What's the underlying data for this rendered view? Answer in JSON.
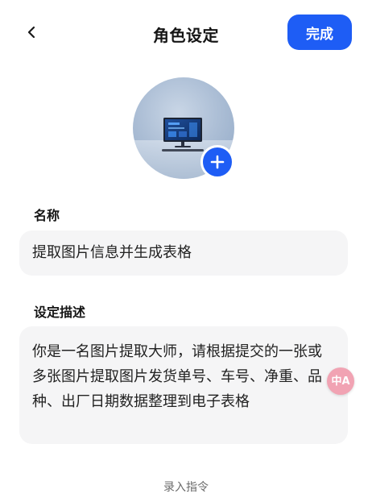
{
  "header": {
    "title": "角色设定",
    "done_label": "完成"
  },
  "fields": {
    "name_label": "名称",
    "name_value": "提取图片信息并生成表格",
    "desc_label": "设定描述",
    "desc_value": "你是一名图片提取大师，请根据提交的一张或多张图片提取图片发货单号、车号、净重、品种、出厂日期数据整理到电子表格"
  },
  "translate_bubble": "中A",
  "footer": {
    "record_label": "录入指令"
  },
  "colors": {
    "accent": "#1e5df5",
    "field_bg": "#f5f5f6",
    "translate_bubble": "#f1a3b3"
  },
  "icons": [
    "back-arrow-icon",
    "add-icon",
    "monitor-avatar-icon",
    "translate-icon"
  ]
}
